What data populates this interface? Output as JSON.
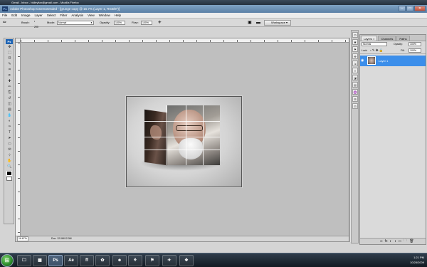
{
  "firefox": {
    "title": "Gmail - Inbox - bkileyfun@gmail.com - Mozilla Firefox"
  },
  "photoshop": {
    "title": "Adobe Photoshop CS3 Extended - [grunge copy @ 16.7% (Layer 1, RGB/8*)]",
    "app_icon": "Ps",
    "window_controls": {
      "minimize": "–",
      "maximize": "□",
      "close": "✕"
    }
  },
  "menu": [
    "File",
    "Edit",
    "Image",
    "Layer",
    "Select",
    "Filter",
    "Analysis",
    "View",
    "Window",
    "Help"
  ],
  "options_bar": {
    "brush_label": "Brush:",
    "brush_size": "200",
    "mode_label": "Mode:",
    "mode_value": "Normal",
    "opacity_label": "Opacity:",
    "opacity_value": "100%",
    "flow_label": "Flow:",
    "flow_value": "100%",
    "workspace_label": "Workspace ▾"
  },
  "toolbox": {
    "logo": "Ps",
    "tools": [
      "move-tool",
      "marquee-tool",
      "lasso-tool",
      "quick-selection-tool",
      "crop-tool",
      "eyedropper-tool",
      "healing-brush-tool",
      "brush-tool",
      "clone-stamp-tool",
      "history-brush-tool",
      "eraser-tool",
      "gradient-tool",
      "blur-tool",
      "dodge-tool",
      "pen-tool",
      "type-tool",
      "path-selection-tool",
      "rectangle-tool",
      "notes-tool",
      "eyedropper-3d-tool",
      "hand-tool",
      "zoom-tool"
    ],
    "tool_glyphs": [
      "✥",
      "⬚",
      "ʘ",
      "✎",
      "⌗",
      "✒",
      "✚",
      "✏",
      "⎘",
      "↺",
      "◫",
      "▤",
      "💧",
      "◐",
      "✑",
      "T",
      "➤",
      "▭",
      "✉",
      "⊹",
      "✋",
      "🔍"
    ]
  },
  "status_bar": {
    "zoom": "16.67%",
    "doc": "Doc: 12.0M/12.0M"
  },
  "layers_panel": {
    "tabs": [
      "Layers ×",
      "Channels",
      "Paths"
    ],
    "blend_mode": "Normal",
    "opacity_label": "Opacity:",
    "opacity_value": "100%",
    "lock_label": "Lock:",
    "fill_label": "Fill:",
    "fill_value": "100%",
    "layer_name": "Layer 1",
    "footer_icons": [
      "∞",
      "fx",
      "◐",
      "◑",
      "▭",
      "🗀",
      "🗑"
    ]
  },
  "dock_icons": [
    "⊡",
    "✱",
    "⚑",
    "✜",
    "⇲",
    "≡",
    "◪",
    "▤",
    "♒",
    "⊞",
    "⊟"
  ],
  "taskbar": {
    "start": "⊞",
    "apps": [
      "🗀",
      "▦",
      "Ps",
      "Ae",
      "ff",
      "✿",
      "☻",
      "⚘",
      "⚑",
      "✈",
      "❖"
    ],
    "time": "1:21 PM",
    "date": "10/28/2009"
  },
  "colors": {
    "selection": "#3b8eea",
    "canvas_bg": "#bfbfbf"
  }
}
